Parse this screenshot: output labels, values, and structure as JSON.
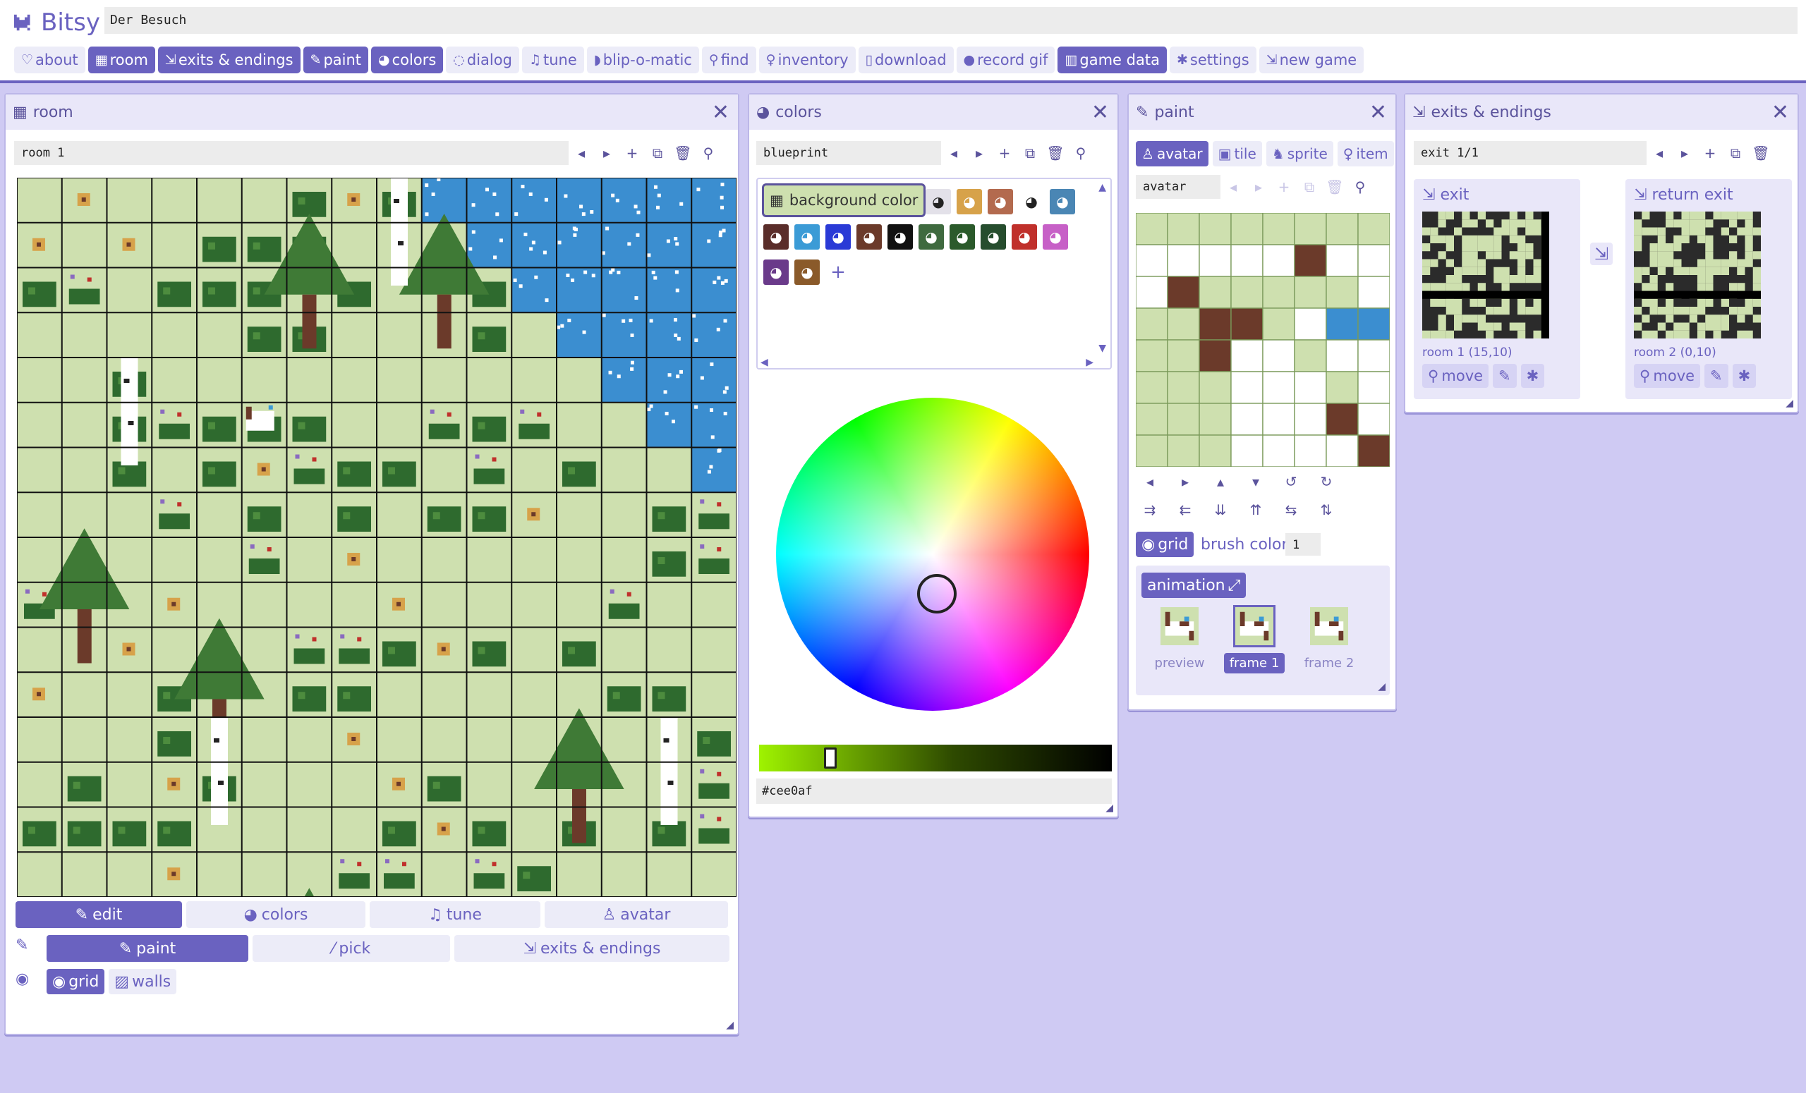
{
  "app": {
    "name": "Bitsy",
    "game_title": "Der Besuch"
  },
  "nav": [
    {
      "icon": "♡",
      "label": "about",
      "on": false
    },
    {
      "icon": "▦",
      "label": "room",
      "on": true
    },
    {
      "icon": "⇲",
      "label": "exits & endings",
      "on": true
    },
    {
      "icon": "✎",
      "label": "paint",
      "on": true
    },
    {
      "icon": "◕",
      "label": "colors",
      "on": true
    },
    {
      "icon": "◌",
      "label": "dialog",
      "on": false
    },
    {
      "icon": "♫",
      "label": "tune",
      "on": false
    },
    {
      "icon": "◗",
      "label": "blip-o-matic",
      "on": false
    },
    {
      "icon": "⚲",
      "label": "find",
      "on": false
    },
    {
      "icon": "♀",
      "label": "inventory",
      "on": false
    },
    {
      "icon": "▯",
      "label": "download",
      "on": false
    },
    {
      "icon": "●",
      "label": "record gif",
      "on": false
    },
    {
      "icon": "▥",
      "label": "game data",
      "on": true
    },
    {
      "icon": "✱",
      "label": "settings",
      "on": false
    },
    {
      "icon": "⇲",
      "label": "new game",
      "on": false
    }
  ],
  "room": {
    "title": "room",
    "name": "room 1",
    "tabs": [
      {
        "icon": "✎",
        "label": "edit",
        "on": true
      },
      {
        "icon": "◕",
        "label": "colors",
        "on": false
      },
      {
        "icon": "♫",
        "label": "tune",
        "on": false
      },
      {
        "icon": "♙",
        "label": "avatar",
        "on": false
      }
    ],
    "tools": [
      {
        "icon": "✎",
        "label": "paint",
        "on": true
      },
      {
        "icon": "⁄",
        "label": "pick",
        "on": false
      },
      {
        "icon": "⇲",
        "label": "exits & endings",
        "on": false
      }
    ],
    "view": [
      {
        "icon": "◉",
        "label": "grid",
        "on": true
      },
      {
        "icon": "▨",
        "label": "walls",
        "on": false
      }
    ]
  },
  "colors": {
    "title": "colors",
    "palette_name": "blueprint",
    "background_label": "background color",
    "hex": "#cee0af",
    "accent": "#6a62c0",
    "swatches": [
      "#e3e1e9",
      "#d7a24a",
      "#b36a4e",
      "#ffffff",
      "#4a86b4",
      "#5a2d2a",
      "#3b9bd6",
      "#2a3ad6",
      "#6b3a2a",
      "#111111",
      "#3f6a3f",
      "#2b5a2b",
      "#264d2e",
      "#c0302b",
      "#c760c7",
      "#6a3a8a",
      "#8a5a2a"
    ],
    "add_label": "+"
  },
  "paint": {
    "title": "paint",
    "types": [
      {
        "icon": "♙",
        "label": "avatar",
        "on": true
      },
      {
        "icon": "▣",
        "label": "tile",
        "on": false
      },
      {
        "icon": "♞",
        "label": "sprite",
        "on": false
      },
      {
        "icon": "♀",
        "label": "item",
        "on": false
      }
    ],
    "name": "avatar",
    "grid_label": "grid",
    "brush_label": "brush color",
    "brush_value": "1",
    "animation_label": "animation",
    "frames": [
      {
        "label": "preview",
        "on": false
      },
      {
        "label": "frame 1",
        "on": true
      },
      {
        "label": "frame 2",
        "on": false
      }
    ]
  },
  "exits": {
    "title": "exits & endings",
    "current": "exit 1/1",
    "exit_label": "exit",
    "return_label": "return exit",
    "exit_loc": "room 1 (15,10)",
    "return_loc": "room 2 (0,10)",
    "move_label": "move"
  }
}
